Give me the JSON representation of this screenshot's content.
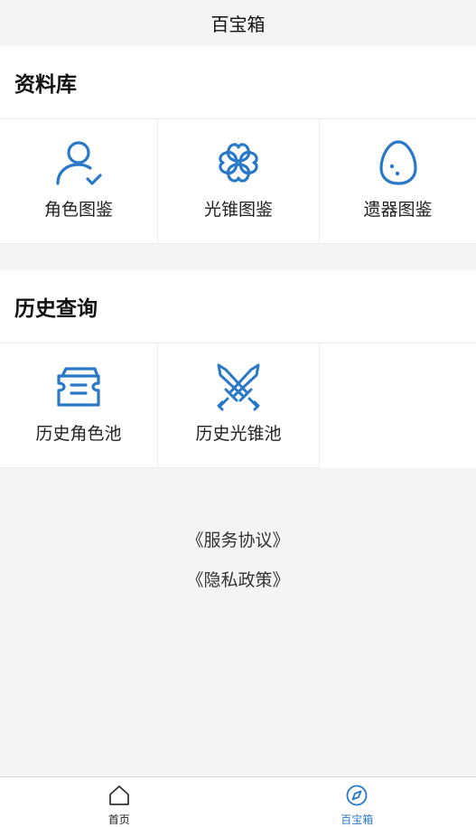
{
  "header": {
    "title": "百宝箱"
  },
  "sections": [
    {
      "title": "资料库",
      "items": [
        {
          "label": "角色图鉴",
          "icon": "person-check-icon"
        },
        {
          "label": "光锥图鉴",
          "icon": "clover-icon"
        },
        {
          "label": "遗器图鉴",
          "icon": "egg-icon"
        }
      ]
    },
    {
      "title": "历史查询",
      "items": [
        {
          "label": "历史角色池",
          "icon": "ticket-icon"
        },
        {
          "label": "历史光锥池",
          "icon": "crossed-swords-icon"
        }
      ]
    }
  ],
  "footer": {
    "links": [
      "《服务协议》",
      "《隐私政策》"
    ]
  },
  "tabbar": {
    "tabs": [
      {
        "label": "首页",
        "icon": "home-icon",
        "active": false
      },
      {
        "label": "百宝箱",
        "icon": "compass-icon",
        "active": true
      }
    ]
  },
  "colors": {
    "accent": "#2a78c8",
    "background": "#f4f4f4"
  }
}
